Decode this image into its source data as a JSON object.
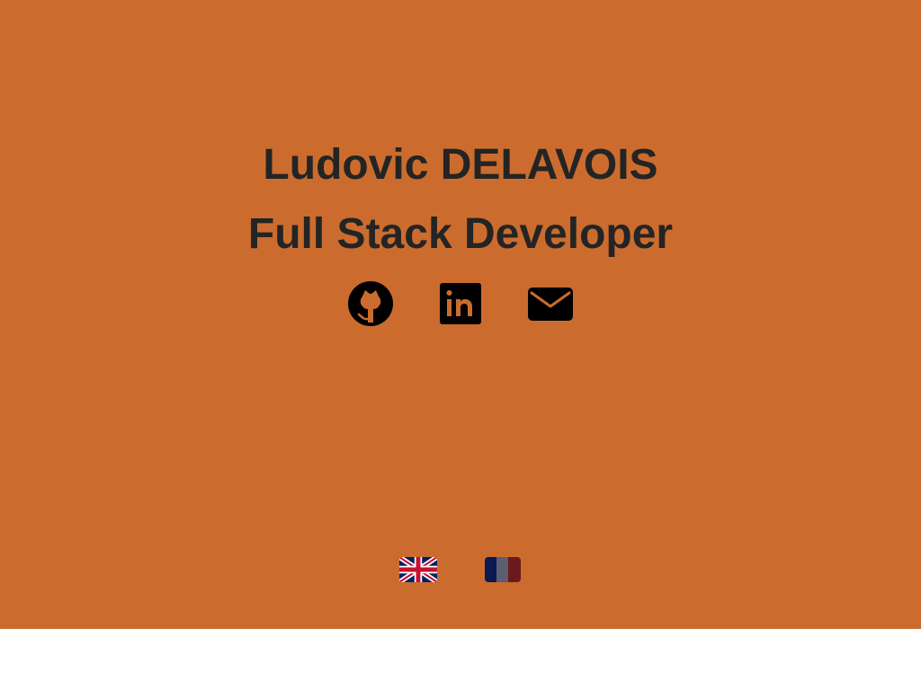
{
  "profile": {
    "name": "Ludovic DELAVOIS",
    "title": "Full Stack Developer"
  },
  "social_links": [
    {
      "icon": "github-icon"
    },
    {
      "icon": "linkedin-icon"
    },
    {
      "icon": "mail-icon"
    }
  ],
  "languages": [
    {
      "icon": "uk-flag-icon",
      "code": "en"
    },
    {
      "icon": "france-flag-icon",
      "code": "fr"
    }
  ],
  "colors": {
    "background": "#cb6c2e",
    "text": "#242424",
    "footer": "#ffffff"
  }
}
